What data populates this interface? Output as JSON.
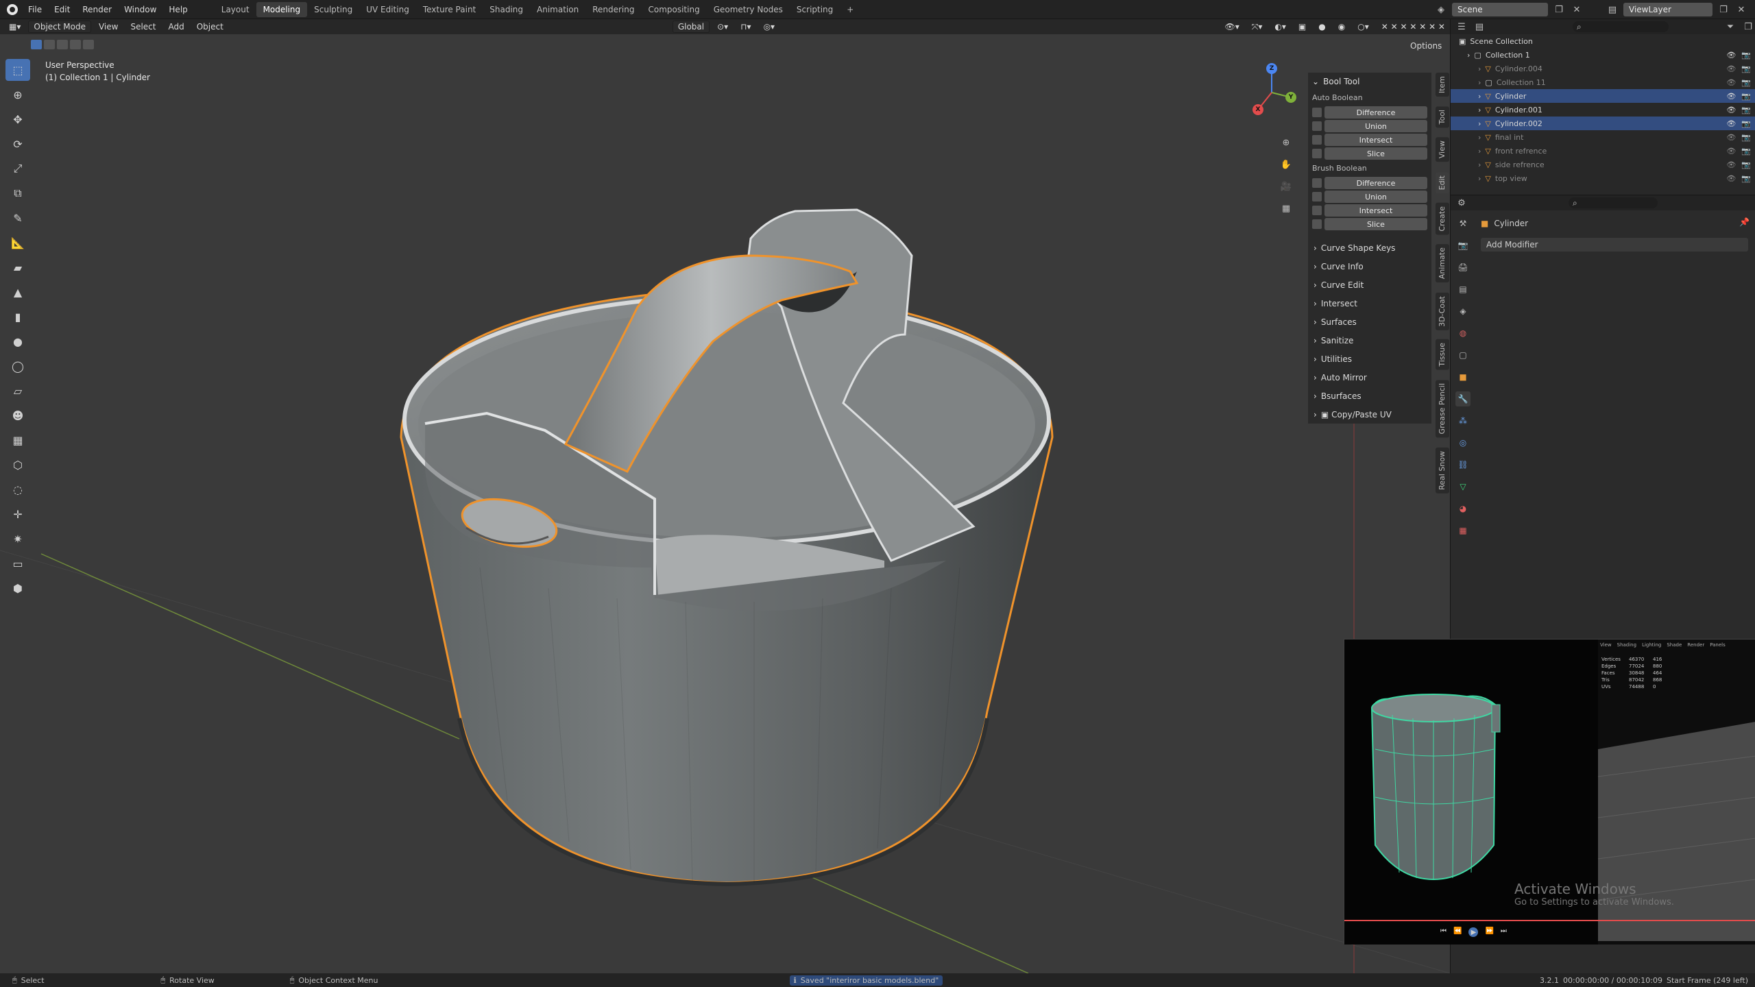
{
  "topbar": {
    "menus": [
      "File",
      "Edit",
      "Render",
      "Window",
      "Help"
    ],
    "workspaces": [
      "Layout",
      "Modeling",
      "Sculpting",
      "UV Editing",
      "Texture Paint",
      "Shading",
      "Animation",
      "Rendering",
      "Compositing",
      "Geometry Nodes",
      "Scripting"
    ],
    "active_workspace": "Modeling",
    "add_tab": "+",
    "scene": "Scene",
    "view_layer": "ViewLayer"
  },
  "viewport": {
    "mode": "Object Mode",
    "menus": [
      "View",
      "Select",
      "Add",
      "Object"
    ],
    "orientation": "Global",
    "options": "Options",
    "perspective": "User Perspective",
    "context": "(1) Collection 1 | Cylinder",
    "gizmo_axes": [
      "X",
      "Y",
      "Z"
    ]
  },
  "bool_tool": {
    "title": "Bool Tool",
    "auto_label": "Auto Boolean",
    "auto_buttons": [
      "Difference",
      "Union",
      "Intersect",
      "Slice"
    ],
    "brush_label": "Brush Boolean",
    "brush_buttons": [
      "Difference",
      "Union",
      "Intersect",
      "Slice"
    ],
    "collapsed": [
      "Curve Shape Keys",
      "Curve Info",
      "Curve Edit",
      "Intersect",
      "Surfaces",
      "Sanitize",
      "Utilities",
      "Auto Mirror",
      "Bsurfaces",
      "Copy/Paste UV"
    ]
  },
  "side_tabs": [
    "Item",
    "Tool",
    "View",
    "Edit",
    "Create",
    "Animate",
    "3D-Coat",
    "Tissue",
    "Grease Pencil",
    "Real Snow"
  ],
  "outliner": {
    "root": "Scene Collection",
    "items": [
      {
        "name": "Collection 1",
        "state": "normal"
      },
      {
        "name": "Cylinder.004",
        "state": "dim"
      },
      {
        "name": "Collection 11",
        "state": "dim"
      },
      {
        "name": "Cylinder",
        "state": "selected"
      },
      {
        "name": "Cylinder.001",
        "state": "normal"
      },
      {
        "name": "Cylinder.002",
        "state": "selected"
      },
      {
        "name": "final int",
        "state": "dim"
      },
      {
        "name": "front refrence",
        "state": "dim"
      },
      {
        "name": "side refrence",
        "state": "dim"
      },
      {
        "name": "top view",
        "state": "dim"
      }
    ]
  },
  "properties": {
    "object_name": "Cylinder",
    "add_modifier": "Add Modifier"
  },
  "overlay": {
    "watermark_title": "Activate Windows",
    "watermark_sub": "Go to Settings to activate Windows.",
    "stats_rows": [
      "Vertices",
      "Edges",
      "Faces",
      "Tris",
      "UVs"
    ],
    "stats_values": [
      "46370",
      "77024",
      "30848",
      "87042",
      "74488"
    ],
    "stats_sel": [
      "416",
      "880",
      "464",
      "868",
      "0"
    ],
    "video_tabs": [
      "View",
      "Shading",
      "Lighting",
      "Shade",
      "Render",
      "Panels"
    ]
  },
  "statusbar": {
    "select": "Select",
    "rotate": "Rotate View",
    "context_menu": "Object Context Menu",
    "message": "Saved \"interiror basic models.blend\"",
    "version": "3.2.1",
    "time": "00:00:00:00 / 00:00:10:09",
    "frame": "Start Frame (249 left)"
  },
  "colors": {
    "accent": "#4772b3",
    "selection_outline": "#f0932b",
    "panel": "#2b2b2b",
    "viewport_bg": "#3a3a3a",
    "model_grey": "#7a7a7a",
    "wire_green": "#3fd8a3"
  },
  "icons": {
    "toolbar": [
      "select-box-icon",
      "cursor-icon",
      "move-icon",
      "rotate-icon",
      "scale-icon",
      "transform-icon",
      "annotate-icon",
      "measure-icon",
      "add-cube-icon",
      "add-cone-icon",
      "add-cylinder-icon",
      "add-sphere-icon",
      "add-torus-icon"
    ],
    "props": [
      "tool-icon",
      "render-icon",
      "output-icon",
      "view-layer-icon",
      "scene-icon",
      "world-icon",
      "collection-icon",
      "object-icon",
      "modifier-icon",
      "particles-icon",
      "physics-icon",
      "constraints-icon",
      "data-icon",
      "material-icon",
      "texture-icon"
    ]
  }
}
